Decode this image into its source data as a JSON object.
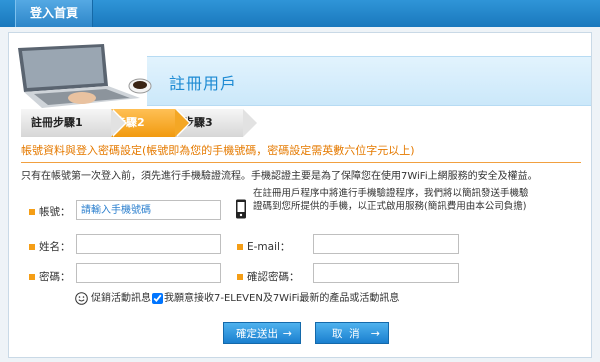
{
  "topbar": {
    "home_label": "登入首頁"
  },
  "banner": {
    "title": "註冊用戶"
  },
  "steps": [
    {
      "label": "註冊步驟1",
      "active": false
    },
    {
      "label": "步驟2",
      "active": true
    },
    {
      "label": "步驟3",
      "active": false
    }
  ],
  "notice": "帳號資料與登入密碼設定(帳號即為您的手機號碼，密碼設定需英數六位字元以上)",
  "description": "只有在帳號第一次登入前，須先進行手機驗證流程。手機認證主要是為了保障您在使用7WiFi上網服務的安全及權益。",
  "form": {
    "account_label": "帳號：",
    "account_placeholder": "請輸入手機號碼",
    "phone_note_line1": "在註冊用戶程序中將進行手機驗證程序，我們將以簡訊發送手機驗",
    "phone_note_line2": "證碼到您所提供的手機，以正式啟用服務(簡訊費用由本公司負擔)",
    "name_label": "姓名：",
    "email_label": "E-mail：",
    "password_label": "密碼：",
    "confirm_password_label": "確認密碼：",
    "promo_prefix": "促銷活動訊息",
    "promo_text": "我願意接收7-ELEVEN及7WiFi最新的產品或活動訊息",
    "promo_checked": true
  },
  "buttons": {
    "submit": "確定送出",
    "cancel": "取  消",
    "arrow": "→"
  },
  "colors": {
    "accent_blue": "#1e8bd3",
    "accent_orange": "#f59e16"
  }
}
